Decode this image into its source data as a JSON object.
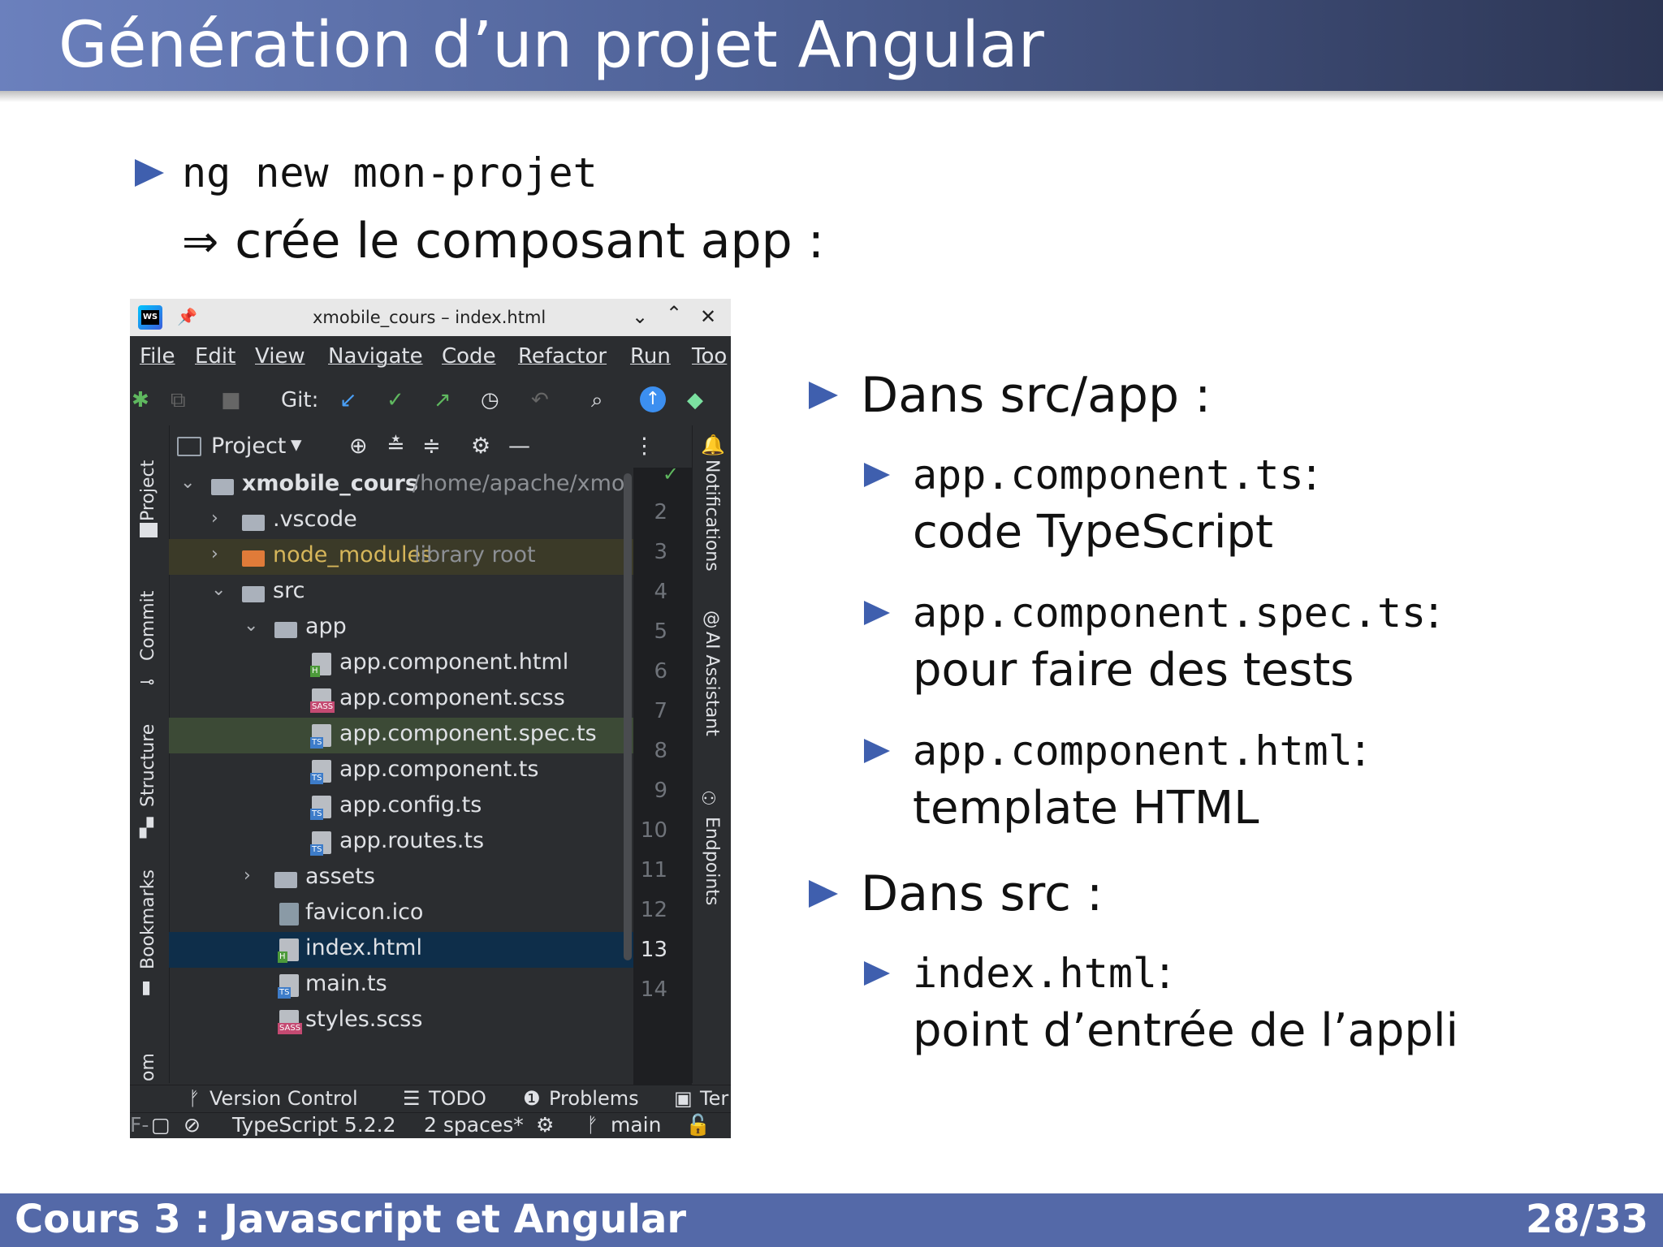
{
  "slide": {
    "title": "Génération d’un projet Angular",
    "cmd": "ng new mon-projet",
    "arrow": "⇒",
    "cmd_desc": "crée le composant app :",
    "sections": [
      {
        "label": "Dans src/app :",
        "items": [
          {
            "code": "app.component.ts",
            "sep": " :",
            "desc": "code TypeScript"
          },
          {
            "code": "app.component.spec.ts",
            "sep": " :",
            "desc": "pour faire des tests"
          },
          {
            "code": "app.component.html",
            "sep": " :",
            "desc": "template HTML"
          }
        ]
      },
      {
        "label": "Dans src :",
        "items": [
          {
            "code": "index.html",
            "sep": " :",
            "desc": "point d’entrée de l’appli"
          }
        ]
      }
    ],
    "footer_left": "Cours 3 : Javascript et Angular",
    "footer_right": "28/33"
  },
  "ide": {
    "window_title": "xmobile_cours – index.html",
    "app_badge": "WS",
    "menu": [
      "File",
      "Edit",
      "View",
      "Navigate",
      "Code",
      "Refactor",
      "Run",
      "Too"
    ],
    "toolbar_git": "Git:",
    "left_tabs": [
      "Project",
      "Commit",
      "Structure",
      "Bookmarks",
      "om"
    ],
    "right_tabs": [
      "Notifications",
      "AI Assistant",
      "Endpoints"
    ],
    "project_header": "Project",
    "tree": [
      {
        "name": "xmobile_cours",
        "sub": "/home/apache/xmol"
      },
      {
        "name": ".vscode"
      },
      {
        "name": "node_modules",
        "sub": "library root"
      },
      {
        "name": "src"
      },
      {
        "name": "app"
      },
      {
        "name": "app.component.html",
        "tag": "H"
      },
      {
        "name": "app.component.scss",
        "tag": "SASS"
      },
      {
        "name": "app.component.spec.ts",
        "tag": "TS"
      },
      {
        "name": "app.component.ts",
        "tag": "TS"
      },
      {
        "name": "app.config.ts",
        "tag": "TS"
      },
      {
        "name": "app.routes.ts",
        "tag": "TS"
      },
      {
        "name": "assets"
      },
      {
        "name": "favicon.ico"
      },
      {
        "name": "index.html",
        "tag": "H"
      },
      {
        "name": "main.ts",
        "tag": "TS"
      },
      {
        "name": "styles.scss",
        "tag": "SASS"
      }
    ],
    "line_numbers": [
      "2",
      "3",
      "4",
      "5",
      "6",
      "7",
      "8",
      "9",
      "10",
      "11",
      "12",
      "13",
      "14"
    ],
    "bottom_tabs": [
      "Version Control",
      "TODO",
      "Problems",
      "Ter"
    ],
    "status": {
      "lang": "TypeScript 5.2.2",
      "indent": "2 spaces*",
      "branch": "main",
      "prefix": "F-"
    },
    "colors": {
      "tag_ts": "#3d7cc9",
      "tag_html": "#4c9a3a",
      "tag_sass": "#c44a72",
      "accent_blue": "#3f5fae"
    }
  }
}
